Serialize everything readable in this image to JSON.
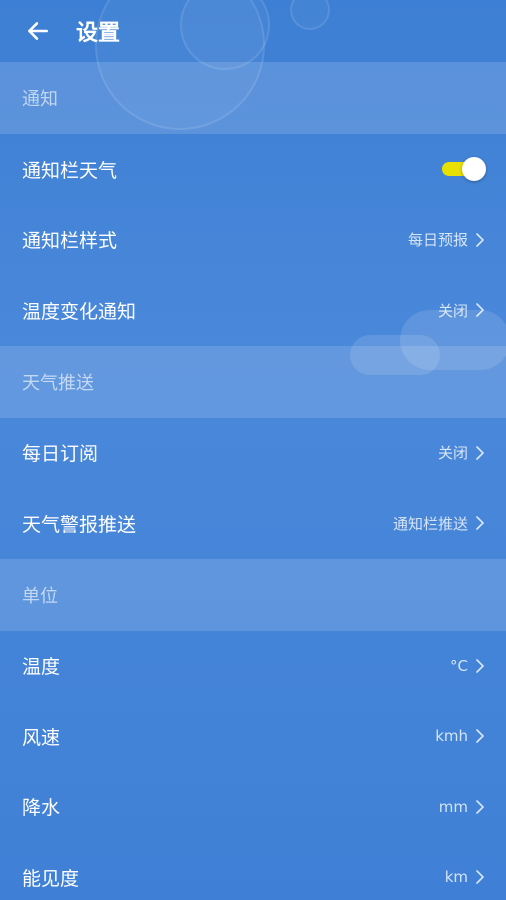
{
  "header": {
    "title": "设置"
  },
  "sections": [
    {
      "title": "通知",
      "rows": [
        {
          "label": "通知栏天气",
          "toggle": true
        },
        {
          "label": "通知栏样式",
          "value": "每日预报"
        },
        {
          "label": "温度变化通知",
          "value": "关闭"
        }
      ]
    },
    {
      "title": "天气推送",
      "rows": [
        {
          "label": "每日订阅",
          "value": "关闭"
        },
        {
          "label": "天气警报推送",
          "value": "通知栏推送"
        }
      ]
    },
    {
      "title": "单位",
      "rows": [
        {
          "label": "温度",
          "value": "°C"
        },
        {
          "label": "风速",
          "value": "kmh"
        },
        {
          "label": "降水",
          "value": "mm"
        },
        {
          "label": "能见度",
          "value": "km"
        }
      ]
    }
  ],
  "colors": {
    "toggle_on": "#e8e000",
    "background": "#4a88da"
  }
}
